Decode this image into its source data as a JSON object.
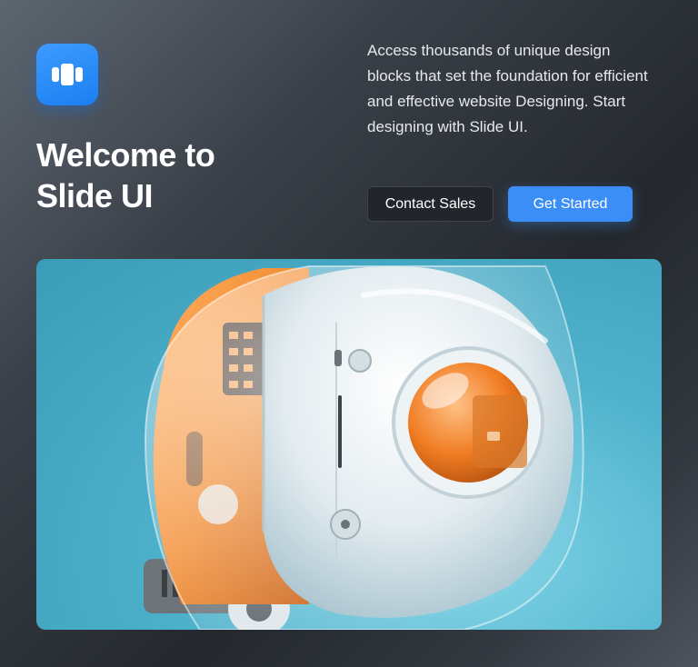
{
  "headline": {
    "line1": "Welcome to",
    "line2": "Slide UI"
  },
  "description": "Access thousands of unique design blocks that set the foundation for efficient and effective website Designing. Start designing with Slide UI.",
  "buttons": {
    "secondary": "Contact Sales",
    "primary": "Get Started"
  },
  "hero_image": {
    "alt": "3D rendered white and orange robotic helmet on a teal background"
  },
  "colors": {
    "accent": "#3b8ef5",
    "logo": "#1a7ff0",
    "background_dark": "#24282e",
    "hero_background": "#4fb2cc",
    "robot_orange": "#f28a2e"
  },
  "icons": {
    "logo": "panels-logo-icon"
  }
}
